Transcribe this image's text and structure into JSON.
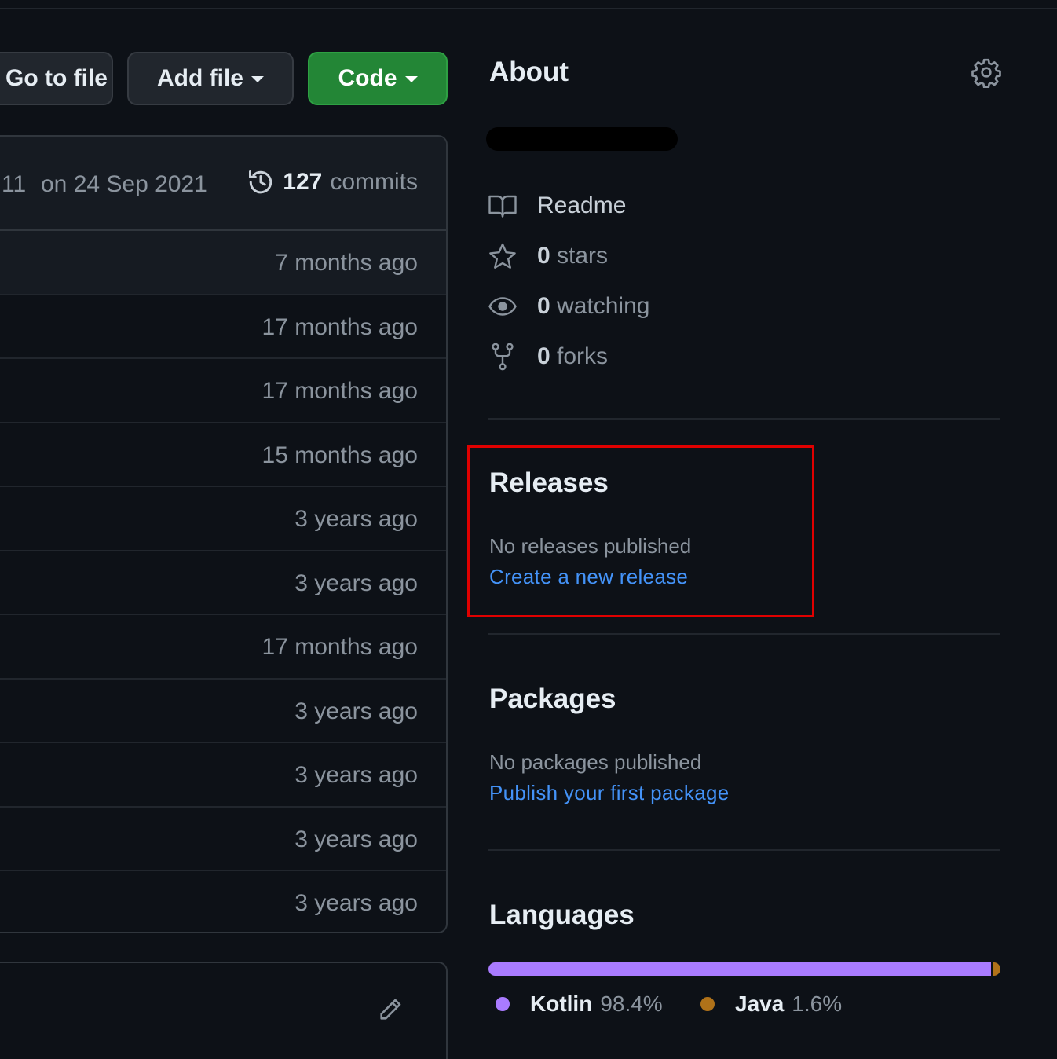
{
  "toolbar": {
    "goto_label": "Go to file",
    "add_file_label": "Add file",
    "code_label": "Code"
  },
  "commit_header": {
    "commit_id_fragment": "11",
    "date": "on 24 Sep 2021",
    "commit_count": "127",
    "commits_label": "commits"
  },
  "file_rows": [
    {
      "age": "7 months ago"
    },
    {
      "age": "17 months ago"
    },
    {
      "age": "17 months ago"
    },
    {
      "age": "15 months ago"
    },
    {
      "age": "3 years ago"
    },
    {
      "age": "3 years ago"
    },
    {
      "age": "17 months ago"
    },
    {
      "age": "3 years ago"
    },
    {
      "age": "3 years ago"
    },
    {
      "age": "3 years ago"
    },
    {
      "age": "3 years ago"
    }
  ],
  "about": {
    "title": "About",
    "readme_label": "Readme",
    "stars_count": "0",
    "stars_label": "stars",
    "watching_count": "0",
    "watching_label": "watching",
    "forks_count": "0",
    "forks_label": "forks"
  },
  "releases": {
    "title": "Releases",
    "empty_text": "No releases published",
    "create_link": "Create a new release"
  },
  "packages": {
    "title": "Packages",
    "empty_text": "No packages published",
    "publish_link": "Publish your first package"
  },
  "languages": {
    "title": "Languages",
    "items": [
      {
        "name": "Kotlin",
        "percent": "98.4%",
        "value": 98.4,
        "color": "#a97bff"
      },
      {
        "name": "Java",
        "percent": "1.6%",
        "value": 1.6,
        "color": "#b07219"
      }
    ]
  },
  "colors": {
    "background": "#0d1117",
    "link": "#4493f8",
    "code_button": "#238636",
    "highlight": "#e00000"
  }
}
